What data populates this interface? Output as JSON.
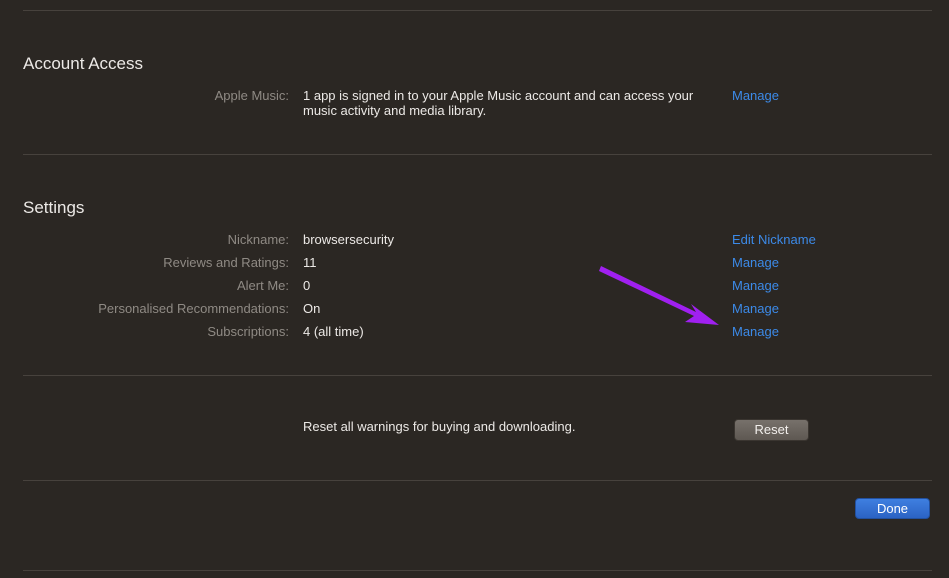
{
  "account_access": {
    "title": "Account Access",
    "apple_music": {
      "label": "Apple Music:",
      "value": "1 app is signed in to your Apple Music account and can access your music activity and media library.",
      "action": "Manage"
    }
  },
  "settings": {
    "title": "Settings",
    "rows": [
      {
        "label": "Nickname:",
        "value": "browsersecurity",
        "action": "Edit Nickname"
      },
      {
        "label": "Reviews and Ratings:",
        "value": "11",
        "action": "Manage"
      },
      {
        "label": "Alert Me:",
        "value": "0",
        "action": "Manage"
      },
      {
        "label": "Personalised Recommendations:",
        "value": "On",
        "action": "Manage"
      },
      {
        "label": "Subscriptions:",
        "value": "4 (all time)",
        "action": "Manage"
      }
    ]
  },
  "warnings": {
    "text": "Reset all warnings for buying and downloading.",
    "reset_label": "Reset"
  },
  "footer": {
    "done_label": "Done"
  },
  "colors": {
    "background": "#2b2723",
    "link": "#3c8ae8",
    "annotation_arrow": "#a020f0"
  },
  "annotation": {
    "icon": "arrow-icon"
  }
}
